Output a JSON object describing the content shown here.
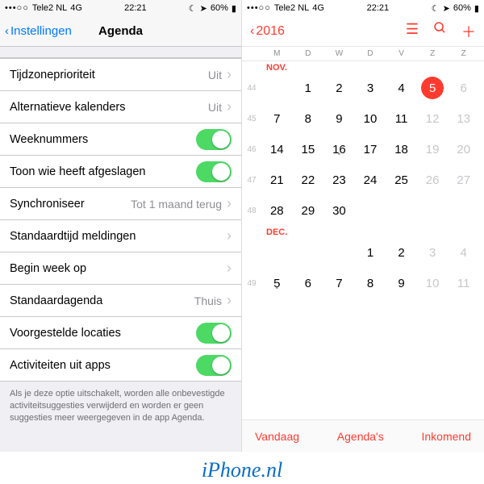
{
  "status": {
    "dots": "•••○○",
    "carrier": "Tele2 NL",
    "net": "4G",
    "time": "22:21",
    "battery": "60%",
    "moon": "☾",
    "loc": "➤"
  },
  "left": {
    "back": "Instellingen",
    "title": "Agenda",
    "rows": [
      {
        "label": "Tijdzoneprioriteit",
        "value": "Uit",
        "type": "link"
      },
      {
        "label": "Alternatieve kalenders",
        "value": "Uit",
        "type": "link"
      },
      {
        "label": "Weeknummers",
        "type": "toggle",
        "on": true
      },
      {
        "label": "Toon wie heeft afgeslagen",
        "type": "toggle",
        "on": true
      },
      {
        "label": "Synchroniseer",
        "value": "Tot 1 maand terug",
        "type": "link"
      },
      {
        "label": "Standaardtijd meldingen",
        "type": "link"
      },
      {
        "label": "Begin week op",
        "type": "link"
      },
      {
        "label": "Standaardagenda",
        "value": "Thuis",
        "type": "link"
      },
      {
        "label": "Voorgestelde locaties",
        "type": "toggle",
        "on": true
      },
      {
        "label": "Activiteiten uit apps",
        "type": "toggle",
        "on": true
      }
    ],
    "footnote": "Als je deze optie uitschakelt, worden alle onbevestigde activiteitsuggesties verwijderd en worden er geen suggesties meer weergegeven in de app Agenda."
  },
  "right": {
    "year": "2016",
    "dow": [
      "M",
      "D",
      "W",
      "D",
      "V",
      "Z",
      "Z"
    ],
    "months": [
      {
        "label": "NOV.",
        "weeks": [
          {
            "wn": "44",
            "days": [
              {
                "n": ""
              },
              {
                "n": "1"
              },
              {
                "n": "2"
              },
              {
                "n": "3"
              },
              {
                "n": "4"
              },
              {
                "n": "5",
                "today": true
              },
              {
                "n": "6",
                "off": true
              }
            ]
          },
          {
            "wn": "45",
            "days": [
              {
                "n": "7"
              },
              {
                "n": "8"
              },
              {
                "n": "9"
              },
              {
                "n": "10"
              },
              {
                "n": "11"
              },
              {
                "n": "12",
                "off": true
              },
              {
                "n": "13",
                "off": true
              }
            ]
          },
          {
            "wn": "46",
            "days": [
              {
                "n": "14"
              },
              {
                "n": "15"
              },
              {
                "n": "16",
                "dot": true
              },
              {
                "n": "17"
              },
              {
                "n": "18"
              },
              {
                "n": "19",
                "off": true
              },
              {
                "n": "20",
                "off": true
              }
            ]
          },
          {
            "wn": "47",
            "days": [
              {
                "n": "21"
              },
              {
                "n": "22"
              },
              {
                "n": "23"
              },
              {
                "n": "24"
              },
              {
                "n": "25"
              },
              {
                "n": "26",
                "off": true
              },
              {
                "n": "27",
                "off": true
              }
            ]
          },
          {
            "wn": "48",
            "days": [
              {
                "n": "28"
              },
              {
                "n": "29"
              },
              {
                "n": "30"
              },
              {
                "n": ""
              },
              {
                "n": ""
              },
              {
                "n": ""
              },
              {
                "n": ""
              }
            ]
          }
        ]
      },
      {
        "label": "DEC.",
        "weeks": [
          {
            "wn": "",
            "days": [
              {
                "n": ""
              },
              {
                "n": ""
              },
              {
                "n": ""
              },
              {
                "n": "1"
              },
              {
                "n": "2"
              },
              {
                "n": "3",
                "off": true
              },
              {
                "n": "4",
                "off": true
              }
            ]
          },
          {
            "wn": "49",
            "days": [
              {
                "n": "5",
                "dot": true
              },
              {
                "n": "6"
              },
              {
                "n": "7"
              },
              {
                "n": "8"
              },
              {
                "n": "9"
              },
              {
                "n": "10",
                "off": true
              },
              {
                "n": "11",
                "off": true
              }
            ]
          }
        ]
      }
    ],
    "toolbar": {
      "today": "Vandaag",
      "calendars": "Agenda's",
      "inbox": "Inkomend"
    }
  },
  "brand": "iPhone.nl"
}
